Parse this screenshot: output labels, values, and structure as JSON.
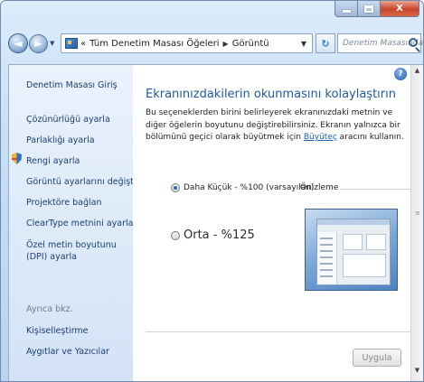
{
  "window": {
    "caption_buttons": {
      "min_icon": "minimize-icon",
      "max_icon": "maximize-icon",
      "close_label": "X"
    }
  },
  "nav": {
    "back_icon": "back-arrow-icon",
    "forward_icon": "forward-arrow-icon",
    "overflow": "«",
    "crumbs": [
      "Tüm Denetim Masası Öğeleri",
      "Görüntü"
    ],
    "search_placeholder": "Denetim Masasında Ara"
  },
  "sidebar": {
    "home": "Denetim Masası Giriş",
    "items": [
      "Çözünürlüğü ayarla",
      "Parlaklığı ayarla",
      "Rengi ayarla",
      "Görüntü ayarlarını değiştir",
      "Projektöre bağlan",
      "ClearType metnini ayarla",
      "Özel metin boyutunu (DPI) ayarla"
    ],
    "see_also_label": "Ayrıca bkz.",
    "see_also": [
      "Kişiselleştirme",
      "Aygıtlar ve Yazıcılar"
    ]
  },
  "main": {
    "title": "Ekranınızdakilerin okunmasını kolaylaştırın",
    "description_before": "Bu seçeneklerden birini belirleyerek ekranınızdaki metnin ve diğer öğelerin boyutunu değiştirebilirsiniz. Ekranın yalnızca bir bölümünü geçici olarak büyütmek için ",
    "description_link": "Büyüteç",
    "description_after": " aracını kullanın.",
    "options": [
      {
        "label": "Daha Küçük - %100 (varsayılan)",
        "selected": true
      },
      {
        "label": "Orta - %125",
        "selected": false
      }
    ],
    "preview_label": "Önizleme",
    "apply_label": "Uygula"
  },
  "colors": {
    "accent": "#1e5aa0",
    "link": "#1b3f6f"
  }
}
